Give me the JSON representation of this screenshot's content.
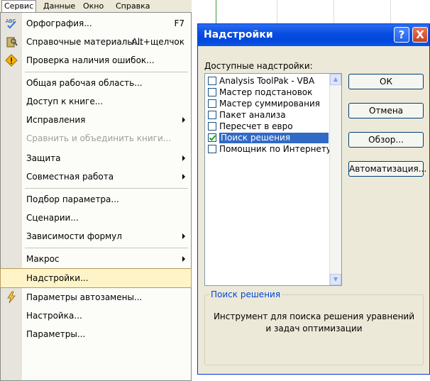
{
  "menubar": {
    "items": [
      "Сервис",
      "Данные",
      "Окно",
      "Справка"
    ]
  },
  "menu": {
    "items": [
      {
        "label": "Орфография...",
        "shortcut": "F7",
        "icon": "spelling-abc-icon"
      },
      {
        "label": "Справочные материалы...",
        "shortcut": "Alt+щелчок",
        "icon": "research-book-icon"
      },
      {
        "label": "Проверка наличия ошибок...",
        "icon": "error-check-icon"
      },
      {
        "label": "Общая рабочая область..."
      },
      {
        "label": "Доступ к книге..."
      },
      {
        "label": "Исправления",
        "submenu": true
      },
      {
        "label": "Сравнить и объединить книги...",
        "disabled": true
      },
      {
        "label": "Защита",
        "submenu": true
      },
      {
        "label": "Совместная работа",
        "submenu": true
      },
      {
        "label": "Подбор параметра..."
      },
      {
        "label": "Сценарии..."
      },
      {
        "label": "Зависимости формул",
        "submenu": true
      },
      {
        "label": "Макрос",
        "submenu": true
      },
      {
        "label": "Надстройки...",
        "highlighted": true
      },
      {
        "label": "Параметры автозамены...",
        "icon": "autocorrect-lightning-icon"
      },
      {
        "label": "Настройка..."
      },
      {
        "label": "Параметры..."
      }
    ]
  },
  "dialog": {
    "title": "Надстройки",
    "help_glyph": "?",
    "close_glyph": "X",
    "available_label": "Доступные надстройки:",
    "addins": [
      {
        "label": "Analysis ToolPak - VBA",
        "checked": false
      },
      {
        "label": "Мастер подстановок",
        "checked": false
      },
      {
        "label": "Мастер суммирования",
        "checked": false
      },
      {
        "label": "Пакет анализа",
        "checked": false
      },
      {
        "label": "Пересчет в евро",
        "checked": false
      },
      {
        "label": "Поиск решения",
        "checked": true,
        "selected": true
      },
      {
        "label": "Помощник по Интернету",
        "checked": false
      }
    ],
    "buttons": {
      "ok": "ОК",
      "cancel": "Отмена",
      "browse": "Обзор...",
      "automation": "Автоматизация..."
    },
    "group": {
      "title": "Поиск решения",
      "description": "Инструмент для поиска решения уравнений и задач оптимизации"
    }
  },
  "colors": {
    "titlebar": "#0a4fe0",
    "selection": "#316ac5",
    "menu_highlight": "#fff4c8",
    "dialog_bg": "#ece9d8"
  }
}
